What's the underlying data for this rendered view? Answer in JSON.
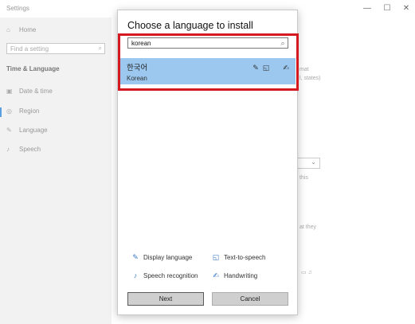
{
  "settings": {
    "title": "Settings",
    "window_controls": [
      "—",
      "☐",
      "✕"
    ],
    "home": "Home",
    "find_placeholder": "Find a setting",
    "section": "Time & Language",
    "nav": [
      {
        "label": "Date & time",
        "icon": "date-time-icon"
      },
      {
        "label": "Region",
        "icon": "region-icon"
      },
      {
        "label": "Language",
        "icon": "language-icon"
      },
      {
        "label": "Speech",
        "icon": "microphone-icon"
      }
    ],
    "background_fragments": [
      "mat",
      "l, states)",
      "this",
      "at they"
    ]
  },
  "dialog": {
    "title": "Choose a language to install",
    "search": {
      "value": "korean"
    },
    "results": [
      {
        "native": "한국어",
        "english": "Korean",
        "features": [
          "display-language-icon",
          "text-to-speech-icon",
          "handwriting-icon"
        ]
      }
    ],
    "legend": [
      {
        "label": "Display language",
        "icon": "display-language-icon"
      },
      {
        "label": "Text-to-speech",
        "icon": "text-to-speech-icon"
      },
      {
        "label": "Speech recognition",
        "icon": "speech-recognition-icon"
      },
      {
        "label": "Handwriting",
        "icon": "handwriting-icon"
      }
    ],
    "buttons": {
      "next": "Next",
      "cancel": "Cancel"
    }
  },
  "colors": {
    "highlight_border": "#d41920",
    "selected_item": "#9cc8f0",
    "accent": "#3a78c2"
  }
}
